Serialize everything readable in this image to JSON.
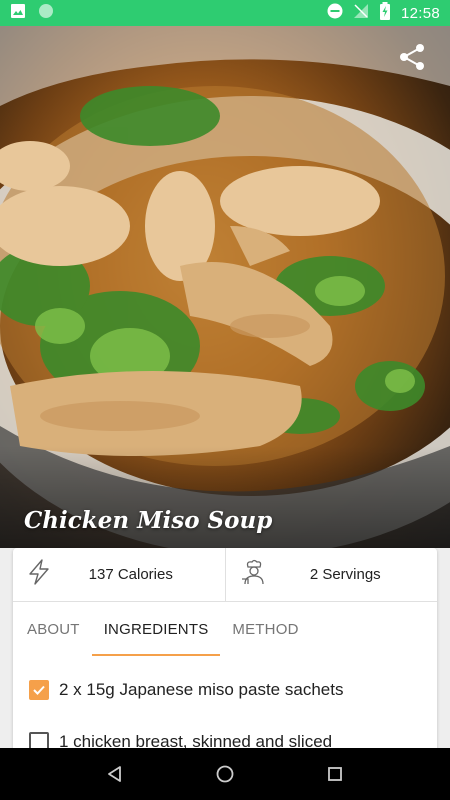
{
  "status_bar": {
    "time": "12:58",
    "color": "#2ecc71"
  },
  "recipe": {
    "title": "Chicken Miso Soup"
  },
  "stats": {
    "calories": "137 Calories",
    "servings": "2 Servings"
  },
  "tabs": [
    {
      "label": "ABOUT",
      "active": false
    },
    {
      "label": "INGREDIENTS",
      "active": true
    },
    {
      "label": "METHOD",
      "active": false
    }
  ],
  "ingredients": [
    {
      "text": "2 x 15g Japanese miso paste sachets",
      "checked": true
    },
    {
      "text": "1 chicken breast, skinned and sliced",
      "checked": false
    }
  ],
  "colors": {
    "accent": "#f5a04a",
    "status_bar": "#2ecc71"
  },
  "icons": {
    "share": "share-icon",
    "calories": "lightning-icon",
    "servings": "chef-icon",
    "nav_back": "triangle-back-icon",
    "nav_home": "circle-home-icon",
    "nav_recents": "square-recents-icon"
  }
}
